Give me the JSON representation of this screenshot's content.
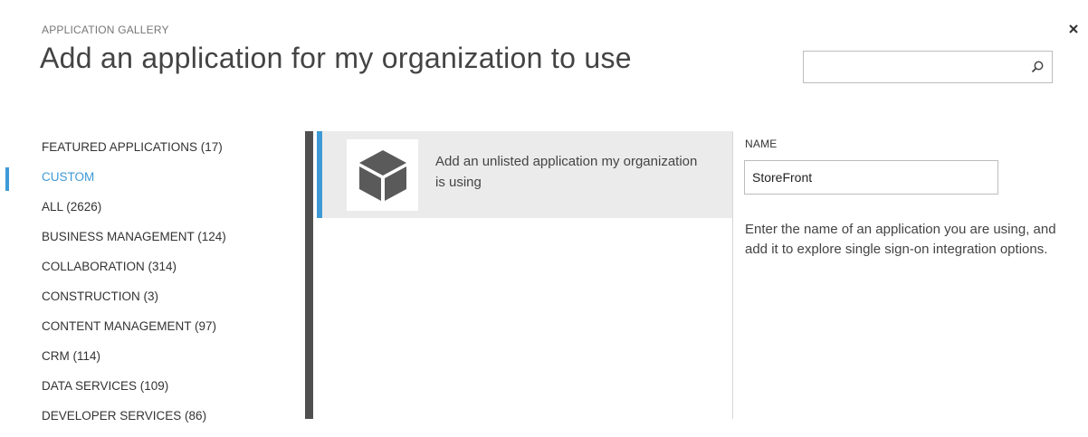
{
  "header": {
    "eyebrow": "APPLICATION GALLERY",
    "title": "Add an application for my organization to use",
    "close_icon": "close-icon"
  },
  "search": {
    "value": "",
    "placeholder": "",
    "icon": "search-icon"
  },
  "categories": {
    "active_index": 1,
    "items": [
      {
        "label": "FEATURED APPLICATIONS (17)"
      },
      {
        "label": "CUSTOM"
      },
      {
        "label": "ALL (2626)"
      },
      {
        "label": "BUSINESS MANAGEMENT (124)"
      },
      {
        "label": "COLLABORATION (314)"
      },
      {
        "label": "CONSTRUCTION (3)"
      },
      {
        "label": "CONTENT MANAGEMENT (97)"
      },
      {
        "label": "CRM (114)"
      },
      {
        "label": "DATA SERVICES (109)"
      },
      {
        "label": "DEVELOPER SERVICES (86)"
      }
    ]
  },
  "app_list": {
    "items": [
      {
        "description": "Add an unlisted application my organization is using",
        "icon": "cube-icon"
      }
    ]
  },
  "details": {
    "name_label": "NAME",
    "name_value": "StoreFront",
    "help_text": "Enter the name of an application you are using, and add it to explore single sign-on integration options."
  },
  "colors": {
    "accent": "#3d9ad6",
    "divider": "#505050",
    "tile_background": "#ebebeb",
    "icon": "#5a5a5a"
  }
}
